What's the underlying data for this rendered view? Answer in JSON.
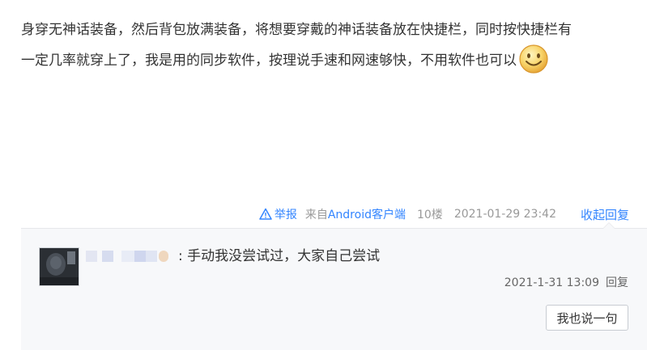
{
  "post": {
    "line1": "身穿无神话装备，然后背包放满装备，将想要穿戴的神话装备放在快捷栏，同时按快捷栏有",
    "line2": "一定几率就穿上了，我是用的同步软件，按理说手速和网速够快，不用软件也可以",
    "emoji_icon": "smiley-face-icon"
  },
  "meta": {
    "report_label": "举报",
    "source_label": "来自",
    "source_link": "Android客户端",
    "floor": "10楼",
    "datetime": "2021-01-29 23:42",
    "collapse_label": "收起回复"
  },
  "reply": {
    "text": ": 手动我没尝试过，大家自己尝试",
    "datetime": "2021-1-31 13:09",
    "reply_label": "回复",
    "say_button_label": "我也说一句"
  },
  "colors": {
    "link": "#3385ff",
    "reply_bg": "#f7f8fa"
  }
}
